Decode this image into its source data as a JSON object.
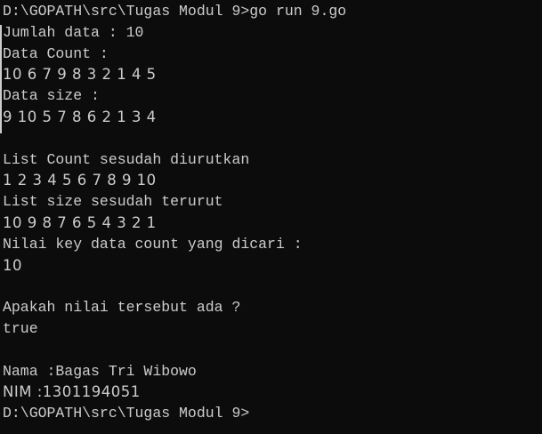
{
  "terminal": {
    "background": "#0c0c0c",
    "text_color": "#cccccc",
    "lines": [
      {
        "text": "D:\\GOPATH\\src\\Tugas Modul 9>go run 9.go",
        "style": "mono"
      },
      {
        "text": "Jumlah data : 10",
        "style": "mono"
      },
      {
        "text": "Data Count :",
        "style": "mono"
      },
      {
        "text": "10 6 7 9 8 3 2 1 4 5",
        "style": "prop"
      },
      {
        "text": "Data size :",
        "style": "mono"
      },
      {
        "text": "9 10 5 7 8 6 2 1 3 4",
        "style": "prop"
      },
      {
        "text": "",
        "style": "mono"
      },
      {
        "text": "List Count sesudah diurutkan",
        "style": "mono"
      },
      {
        "text": "1 2 3 4 5 6 7 8 9 10",
        "style": "prop"
      },
      {
        "text": "List size sesudah terurut",
        "style": "mono"
      },
      {
        "text": "10 9 8 7 6 5 4 3 2 1",
        "style": "prop"
      },
      {
        "text": "Nilai key data count yang dicari :",
        "style": "mono"
      },
      {
        "text": "10",
        "style": "prop"
      },
      {
        "text": "",
        "style": "mono"
      },
      {
        "text": "Apakah nilai tersebut ada ?",
        "style": "mono"
      },
      {
        "text": "true",
        "style": "mono"
      },
      {
        "text": "",
        "style": "mono"
      },
      {
        "text": "Nama :Bagas Tri Wibowo",
        "style": "mono"
      },
      {
        "text": "NIM :1301194051",
        "style": "prop"
      },
      {
        "text": "D:\\GOPATH\\src\\Tugas Modul 9>",
        "style": "mono"
      }
    ]
  }
}
